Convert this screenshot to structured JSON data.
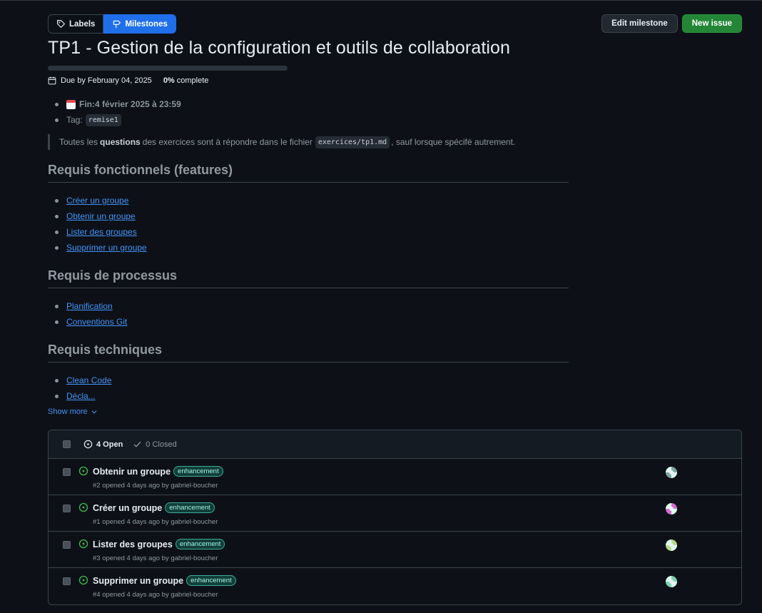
{
  "header": {
    "labels_tab": "Labels",
    "milestones_tab": "Milestones",
    "edit_button": "Edit milestone",
    "new_issue_button": "New issue"
  },
  "milestone": {
    "title": "TP1 - Gestion de la configuration et outils de collaboration",
    "due": "Due by February 04, 2025",
    "percent": "0%",
    "percent_suffix": " complete",
    "progress_fraction": 0
  },
  "description": {
    "fin_label": "Fin:",
    "fin_value": " 4 février 2025 à 23:59",
    "tag_label": "Tag:",
    "tag_value": "remise1",
    "quote_pre": "Toutes les",
    "quote_bold": "questions",
    "quote_mid": "des exercices sont à répondre dans le fichier",
    "quote_code": "exercices/tp1.md",
    "quote_post": ", sauf lorsque spécifé autrement.",
    "sections": [
      {
        "heading": "Requis fonctionnels (features)",
        "links": [
          "Créer un groupe",
          "Obtenir un groupe",
          "Lister des groupes",
          "Supprimer un groupe"
        ]
      },
      {
        "heading": "Requis de processus",
        "links": [
          "Planification",
          "Conventions Git"
        ]
      },
      {
        "heading": "Requis techniques",
        "links": [
          "Clean Code",
          "Décla..."
        ]
      }
    ],
    "show_more": "Show more"
  },
  "issues": {
    "open_count": "4 Open",
    "closed_count": "0 Closed",
    "rows": [
      {
        "title": "Obtenir un groupe",
        "label": "enhancement",
        "meta": "#2 opened 4 days ago by gabriel-boucher",
        "avatar_color": "#7fa8a0"
      },
      {
        "title": "Créer un groupe",
        "label": "enhancement",
        "meta": "#1 opened 4 days ago by gabriel-boucher",
        "avatar_color": "#d46fd0"
      },
      {
        "title": "Lister des groupes",
        "label": "enhancement",
        "meta": "#3 opened 4 days ago by gabriel-boucher",
        "avatar_color": "#b8d98a"
      },
      {
        "title": "Supprimer un groupe",
        "label": "enhancement",
        "meta": "#4 opened 4 days ago by gabriel-boucher",
        "avatar_color": "#7fd3b0"
      }
    ]
  }
}
